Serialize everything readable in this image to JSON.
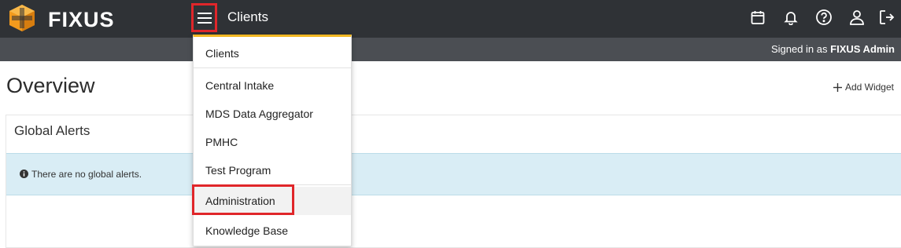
{
  "brand": {
    "name": "FIXUS"
  },
  "header": {
    "title": "Clients"
  },
  "icons": {
    "menu": "hamburger-menu-icon",
    "calendar": "calendar-icon",
    "notifications": "bell-icon",
    "help": "help-icon",
    "user": "user-icon",
    "logout": "logout-icon",
    "info": "info-icon"
  },
  "subheader": {
    "signed_in_prefix": "Signed in as",
    "user_name": "FIXUS Admin"
  },
  "main": {
    "title": "Overview",
    "add_widget_label": "Add Widget",
    "panel": {
      "title": "Global Alerts",
      "alert_text": "There are no global alerts."
    }
  },
  "menu": {
    "items": [
      {
        "label": "Clients"
      },
      {
        "label": "Central Intake"
      },
      {
        "label": "MDS Data Aggregator"
      },
      {
        "label": "PMHC"
      },
      {
        "label": "Test Program"
      },
      {
        "label": "Administration"
      },
      {
        "label": "Knowledge Base"
      }
    ]
  },
  "colors": {
    "topbar": "#2f3236",
    "subbar": "#4b4e53",
    "accent": "#f2b722",
    "highlight_box": "#e0262a",
    "alert_bg": "#d9edf5"
  }
}
